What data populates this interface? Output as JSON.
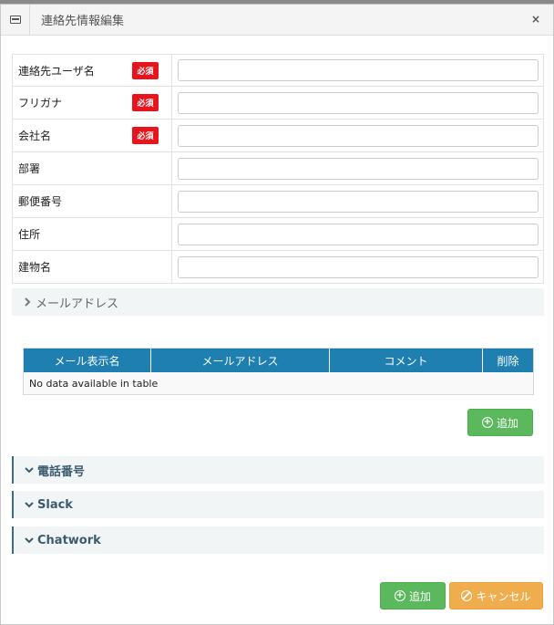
{
  "dialog": {
    "title": "連絡先情報編集",
    "close_glyph": "×"
  },
  "form": {
    "required_badge": "必須",
    "fields": [
      {
        "label": "連絡先ユーザ名",
        "required": true,
        "value": ""
      },
      {
        "label": "フリガナ",
        "required": true,
        "value": ""
      },
      {
        "label": "会社名",
        "required": true,
        "value": ""
      },
      {
        "label": "部署",
        "required": false,
        "value": ""
      },
      {
        "label": "郵便番号",
        "required": false,
        "value": ""
      },
      {
        "label": "住所",
        "required": false,
        "value": ""
      },
      {
        "label": "建物名",
        "required": false,
        "value": ""
      }
    ]
  },
  "sections": {
    "mail": {
      "label": "メールアドレス",
      "icon": "chevron-right-icon"
    },
    "phone": {
      "label": "電話番号",
      "icon": "chevron-down-icon"
    },
    "slack": {
      "label": "Slack",
      "icon": "chevron-down-icon"
    },
    "chatwork": {
      "label": "Chatwork",
      "icon": "chevron-down-icon"
    }
  },
  "mail_table": {
    "columns": [
      "メール表示名",
      "メールアドレス",
      "コメント",
      "削除"
    ],
    "empty_text": "No data available in table",
    "add_label": "追加"
  },
  "footer": {
    "add_label": "追加",
    "cancel_label": "キャンセル"
  },
  "colors": {
    "table_header": "#1e7fb0",
    "required": "#e8141c",
    "success": "#5cb85c",
    "warning": "#f0ad4e"
  }
}
